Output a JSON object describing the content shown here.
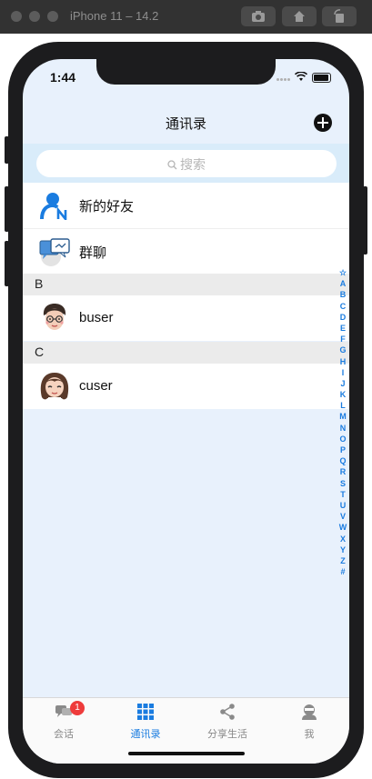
{
  "simulator": {
    "title": "iPhone 11 – 14.2"
  },
  "status": {
    "time": "1:44"
  },
  "nav": {
    "title": "通讯录"
  },
  "search": {
    "placeholder": "搜索"
  },
  "contacts": {
    "new_friends": "新的好友",
    "group_chat": "群聊",
    "sections": [
      {
        "letter": "B",
        "name": "buser"
      },
      {
        "letter": "C",
        "name": "cuser"
      }
    ]
  },
  "index": [
    "☆",
    "A",
    "B",
    "C",
    "D",
    "E",
    "F",
    "G",
    "H",
    "I",
    "J",
    "K",
    "L",
    "M",
    "N",
    "O",
    "P",
    "Q",
    "R",
    "S",
    "T",
    "U",
    "V",
    "W",
    "X",
    "Y",
    "Z",
    "#"
  ],
  "tabs": [
    {
      "label": "会话",
      "icon": "chat-icon",
      "badge": "1"
    },
    {
      "label": "通讯录",
      "icon": "grid-icon",
      "active": true
    },
    {
      "label": "分享生活",
      "icon": "share-icon"
    },
    {
      "label": "我",
      "icon": "person-icon"
    }
  ],
  "colors": {
    "accent": "#1a7ce0",
    "badge": "#ee3b3b",
    "screen_bg": "#e8f1fc",
    "search_bg": "#d9ecfa"
  }
}
